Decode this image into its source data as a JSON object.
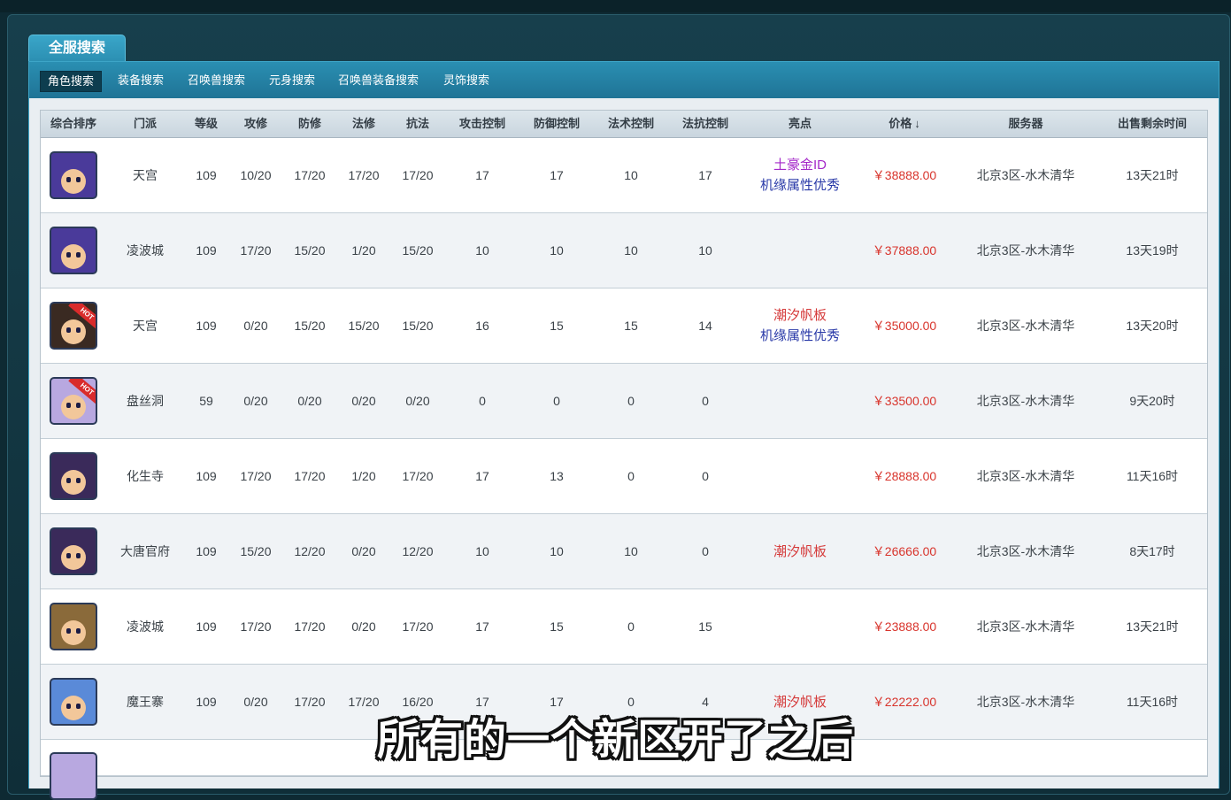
{
  "tab_title": "全服搜索",
  "subnav": [
    {
      "label": "角色搜索",
      "active": true
    },
    {
      "label": "装备搜索",
      "active": false
    },
    {
      "label": "召唤兽搜索",
      "active": false
    },
    {
      "label": "元身搜索",
      "active": false
    },
    {
      "label": "召唤兽装备搜索",
      "active": false
    },
    {
      "label": "灵饰搜索",
      "active": false
    }
  ],
  "columns": [
    "综合排序",
    "门派",
    "等级",
    "攻修",
    "防修",
    "法修",
    "抗法",
    "攻击控制",
    "防御控制",
    "法术控制",
    "法抗控制",
    "亮点",
    "价格",
    "服务器",
    "出售剩余时间"
  ],
  "price_sort_icon": "↓",
  "rows": [
    {
      "avatar": {
        "hair": "#4a3a9a",
        "hot": false
      },
      "sect": "天宫",
      "level": "109",
      "atk": "10/20",
      "def": "17/20",
      "mag": "17/20",
      "res": "17/20",
      "c1": "17",
      "c2": "17",
      "c3": "10",
      "c4": "17",
      "hl": [
        {
          "text": "土豪金ID",
          "color": "purple"
        },
        {
          "text": "机缘属性优秀",
          "color": "blue"
        }
      ],
      "price": "￥38888.00",
      "server": "北京3区-水木清华",
      "time": "13天21时"
    },
    {
      "avatar": {
        "hair": "#4a3a9a",
        "hot": false
      },
      "sect": "凌波城",
      "level": "109",
      "atk": "17/20",
      "def": "15/20",
      "mag": "1/20",
      "res": "15/20",
      "c1": "10",
      "c2": "10",
      "c3": "10",
      "c4": "10",
      "hl": [],
      "price": "￥37888.00",
      "server": "北京3区-水木清华",
      "time": "13天19时"
    },
    {
      "avatar": {
        "hair": "#3a2a22",
        "hot": true
      },
      "sect": "天宫",
      "level": "109",
      "atk": "0/20",
      "def": "15/20",
      "mag": "15/20",
      "res": "15/20",
      "c1": "16",
      "c2": "15",
      "c3": "15",
      "c4": "14",
      "hl": [
        {
          "text": "潮汐帆板",
          "color": "red"
        },
        {
          "text": "机缘属性优秀",
          "color": "blue"
        }
      ],
      "price": "￥35000.00",
      "server": "北京3区-水木清华",
      "time": "13天20时"
    },
    {
      "avatar": {
        "hair": "#b8a8e0",
        "hot": true
      },
      "sect": "盘丝洞",
      "level": "59",
      "atk": "0/20",
      "def": "0/20",
      "mag": "0/20",
      "res": "0/20",
      "c1": "0",
      "c2": "0",
      "c3": "0",
      "c4": "0",
      "hl": [],
      "price": "￥33500.00",
      "server": "北京3区-水木清华",
      "time": "9天20时"
    },
    {
      "avatar": {
        "hair": "#3a2a5a",
        "hot": false
      },
      "sect": "化生寺",
      "level": "109",
      "atk": "17/20",
      "def": "17/20",
      "mag": "1/20",
      "res": "17/20",
      "c1": "17",
      "c2": "13",
      "c3": "0",
      "c4": "0",
      "hl": [],
      "price": "￥28888.00",
      "server": "北京3区-水木清华",
      "time": "11天16时"
    },
    {
      "avatar": {
        "hair": "#3a2a5a",
        "hot": false
      },
      "sect": "大唐官府",
      "level": "109",
      "atk": "15/20",
      "def": "12/20",
      "mag": "0/20",
      "res": "12/20",
      "c1": "10",
      "c2": "10",
      "c3": "10",
      "c4": "0",
      "hl": [
        {
          "text": "潮汐帆板",
          "color": "red"
        }
      ],
      "price": "￥26666.00",
      "server": "北京3区-水木清华",
      "time": "8天17时"
    },
    {
      "avatar": {
        "hair": "#8a6a3a",
        "hot": false
      },
      "sect": "凌波城",
      "level": "109",
      "atk": "17/20",
      "def": "17/20",
      "mag": "0/20",
      "res": "17/20",
      "c1": "17",
      "c2": "15",
      "c3": "0",
      "c4": "15",
      "hl": [],
      "price": "￥23888.00",
      "server": "北京3区-水木清华",
      "time": "13天21时"
    },
    {
      "avatar": {
        "hair": "#5a8ad8",
        "hot": false
      },
      "sect": "魔王寨",
      "level": "109",
      "atk": "0/20",
      "def": "17/20",
      "mag": "17/20",
      "res": "16/20",
      "c1": "17",
      "c2": "17",
      "c3": "0",
      "c4": "4",
      "hl": [
        {
          "text": "潮汐帆板",
          "color": "red"
        }
      ],
      "price": "￥22222.00",
      "server": "北京3区-水木清华",
      "time": "11天16时"
    }
  ],
  "subtitle": "所有的一个新区开了之后"
}
